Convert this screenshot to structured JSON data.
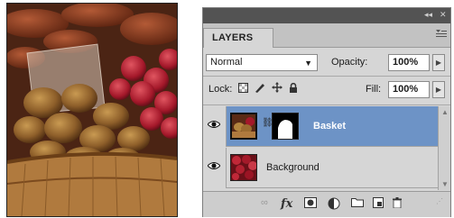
{
  "panel": {
    "tab_label": "LAYERS",
    "collapse_label": "◂◂",
    "close_label": "✕"
  },
  "blend": {
    "value": "Normal"
  },
  "opacity": {
    "label": "Opacity:",
    "value": "100%"
  },
  "lock": {
    "label": "Lock:"
  },
  "fill": {
    "label": "Fill:",
    "value": "100%"
  },
  "layers": [
    {
      "name": "Basket",
      "selected": true,
      "visible": true
    },
    {
      "name": "Background",
      "selected": false,
      "visible": true
    }
  ],
  "colors": {
    "selection": "#6d93c6",
    "panel_bg": "#d6d6d6",
    "titlebar": "#535353"
  },
  "footer_icons": [
    "link-icon",
    "fx-icon",
    "mask-icon",
    "adjustment-icon",
    "group-icon",
    "new-layer-icon",
    "trash-icon"
  ]
}
